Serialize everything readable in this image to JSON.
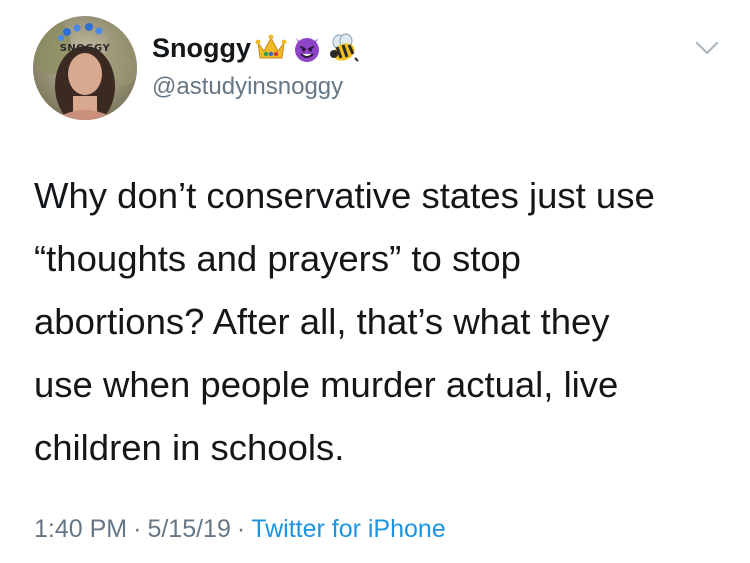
{
  "tweet": {
    "avatar_label": "SNOGGY",
    "display_name": "Snoggy",
    "name_emojis": [
      "crown-emoji",
      "smiling-imp-emoji",
      "bee-emoji"
    ],
    "handle": "@astudyinsnoggy",
    "text": "Why don’t conservative states just use\n“thoughts and prayers” to stop\nabortions? After all, that’s what they\nuse when people murder actual, live\nchildren in schools.",
    "time": "1:40 PM",
    "date": "5/15/19",
    "separator": "·",
    "source": "Twitter for iPhone",
    "menu_icon": "chevron-down-icon"
  },
  "colors": {
    "text": "#14171a",
    "secondary": "#657786",
    "link": "#1b95e0",
    "background": "#ffffff"
  }
}
